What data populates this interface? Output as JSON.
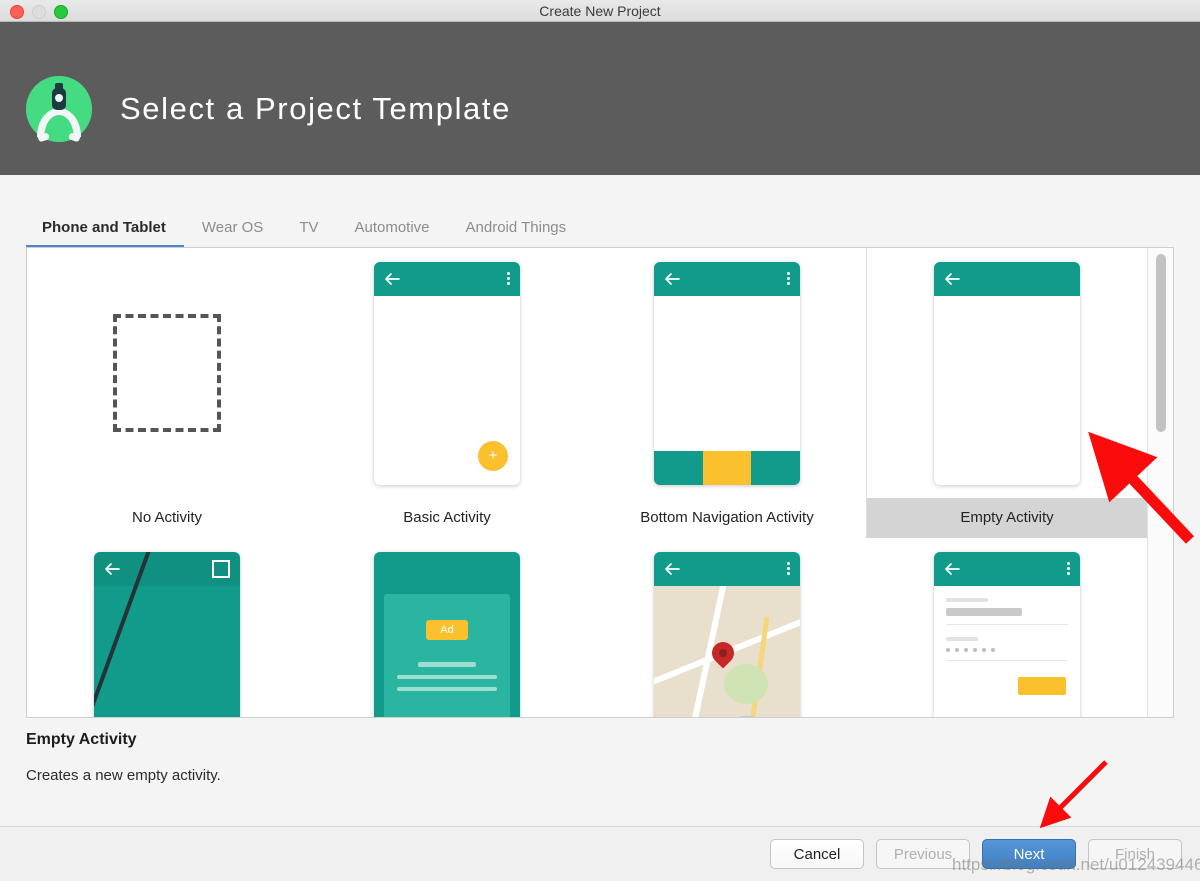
{
  "window": {
    "title": "Create New Project",
    "traffic_lights": [
      "close-button",
      "minimize-button",
      "maximize-button"
    ]
  },
  "header": {
    "title": "Select a Project Template",
    "logo_icon": "android-studio-logo",
    "background_color": "#5c5c5c"
  },
  "tabs": {
    "active_index": 0,
    "items": [
      {
        "label": "Phone and Tablet"
      },
      {
        "label": "Wear OS"
      },
      {
        "label": "TV"
      },
      {
        "label": "Automotive"
      },
      {
        "label": "Android Things"
      }
    ]
  },
  "templates": {
    "selected": "Empty Activity",
    "items": [
      {
        "label": "No Activity",
        "thumb": "dashed-square"
      },
      {
        "label": "Basic Activity",
        "thumb": "appbar-fab"
      },
      {
        "label": "Bottom Navigation Activity",
        "thumb": "appbar-bottomnav"
      },
      {
        "label": "Empty Activity",
        "thumb": "appbar-empty"
      },
      {
        "label": "",
        "thumb": "fullscreen"
      },
      {
        "label": "",
        "thumb": "ad-card"
      },
      {
        "label": "",
        "thumb": "map"
      },
      {
        "label": "",
        "thumb": "login-form"
      }
    ],
    "ad_badge_label": "Ad"
  },
  "description": {
    "title": "Empty Activity",
    "body": "Creates a new empty activity."
  },
  "footer": {
    "buttons": [
      {
        "label": "Cancel",
        "state": "enabled"
      },
      {
        "label": "Previous",
        "state": "disabled"
      },
      {
        "label": "Next",
        "state": "primary"
      },
      {
        "label": "Finish",
        "state": "disabled"
      }
    ]
  },
  "annotations": {
    "arrow_color": "#fb0b0b",
    "arrows": [
      "arrow-pointing-to-empty-activity",
      "arrow-pointing-to-next-button"
    ]
  },
  "watermark": {
    "text": "https://blog.csdn.net/u012439446"
  },
  "colors": {
    "teal": "#119b8b",
    "amber": "#fbc02d",
    "accent_blue": "#4a86c8",
    "selection_gray": "#d4d4d4"
  }
}
